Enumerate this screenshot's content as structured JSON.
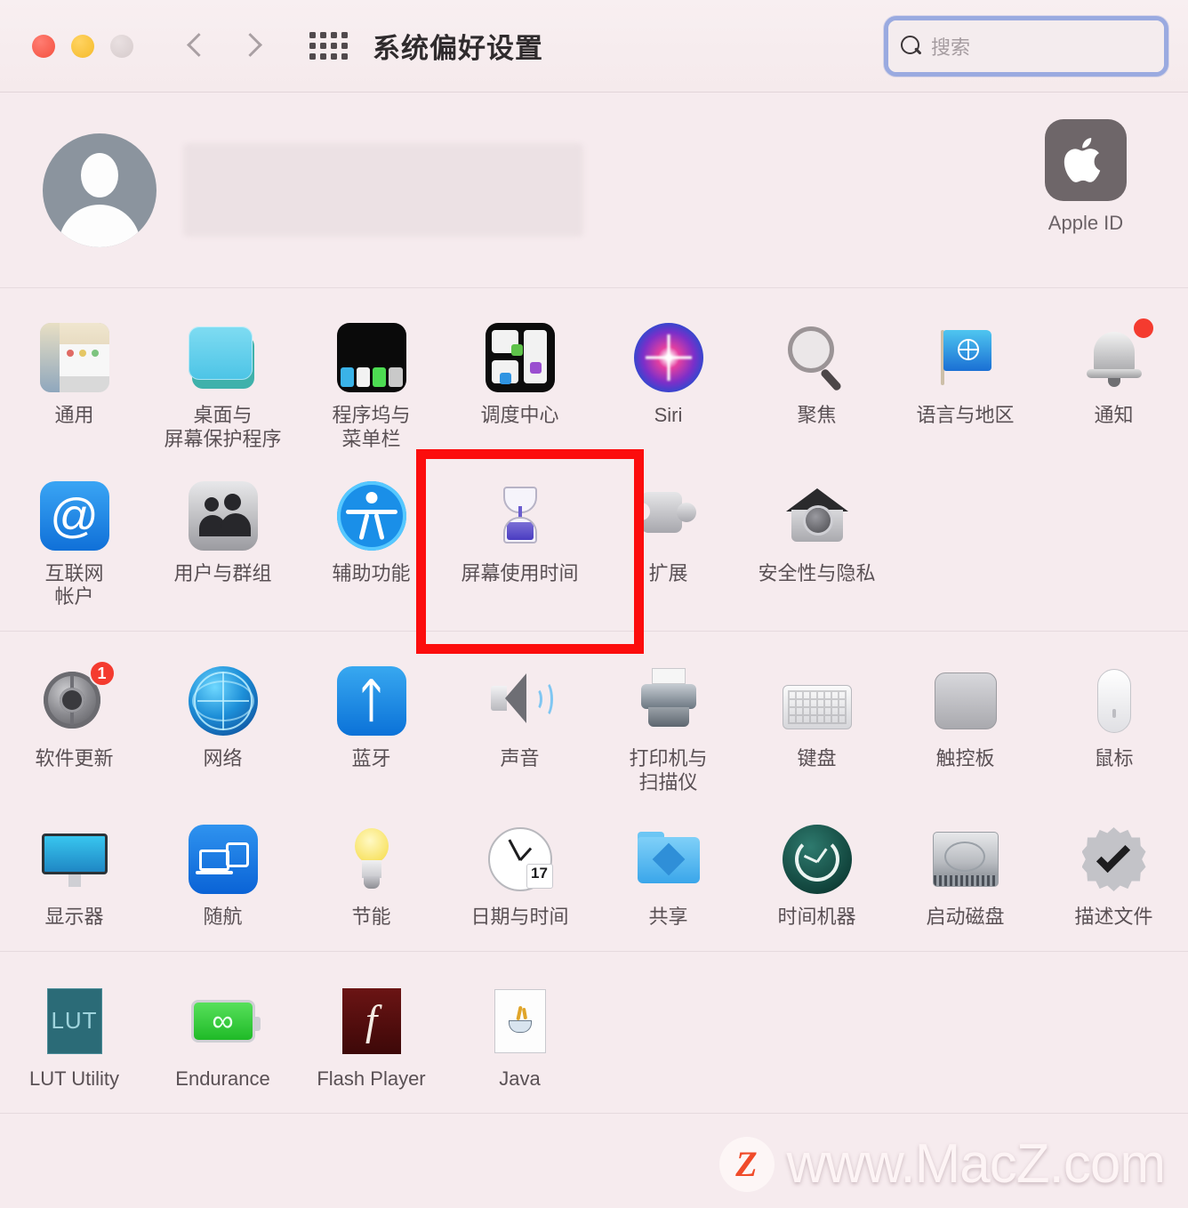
{
  "window": {
    "title": "系统偏好设置",
    "traffic_lights": [
      "close-red",
      "minimize-yellow",
      "zoom-disabled-gray"
    ],
    "nav": {
      "back": "back-chevron",
      "forward": "forward-chevron"
    },
    "show_all_icon": "grid-icon"
  },
  "search": {
    "placeholder": "搜索",
    "value": "",
    "icon": "search-icon",
    "focused": true,
    "focus_ring_color": "#9aaae0"
  },
  "account": {
    "avatar_icon": "default-user-avatar",
    "name_redacted": true,
    "apple_id": {
      "label": "Apple ID",
      "icon": "apple-logo-icon"
    }
  },
  "sections": [
    {
      "name": "personal",
      "items": [
        {
          "label": "通用",
          "icon": "general-icon"
        },
        {
          "label": "桌面与\n屏幕保护程序",
          "icon": "desktop-screensaver-icon"
        },
        {
          "label": "程序坞与\n菜单栏",
          "icon": "dock-menubar-icon"
        },
        {
          "label": "调度中心",
          "icon": "mission-control-icon"
        },
        {
          "label": "Siri",
          "icon": "siri-icon"
        },
        {
          "label": "聚焦",
          "icon": "spotlight-icon"
        },
        {
          "label": "语言与地区",
          "icon": "language-region-icon"
        },
        {
          "label": "通知",
          "icon": "notifications-bell-icon",
          "badge": ""
        },
        {
          "label": "互联网\n帐户",
          "icon": "internet-accounts-icon"
        },
        {
          "label": "用户与群组",
          "icon": "users-groups-icon"
        },
        {
          "label": "辅助功能",
          "icon": "accessibility-icon"
        },
        {
          "label": "屏幕使用时间",
          "icon": "screen-time-hourglass-icon",
          "highlighted": true
        },
        {
          "label": "扩展",
          "icon": "extensions-puzzle-icon"
        },
        {
          "label": "安全性与隐私",
          "icon": "security-privacy-icon"
        }
      ]
    },
    {
      "name": "hardware",
      "items": [
        {
          "label": "软件更新",
          "icon": "software-update-icon",
          "badge": "1"
        },
        {
          "label": "网络",
          "icon": "network-globe-icon"
        },
        {
          "label": "蓝牙",
          "icon": "bluetooth-icon"
        },
        {
          "label": "声音",
          "icon": "sound-speaker-icon"
        },
        {
          "label": "打印机与\n扫描仪",
          "icon": "printers-scanners-icon"
        },
        {
          "label": "键盘",
          "icon": "keyboard-icon"
        },
        {
          "label": "触控板",
          "icon": "trackpad-icon"
        },
        {
          "label": "鼠标",
          "icon": "mouse-icon"
        },
        {
          "label": "显示器",
          "icon": "displays-icon"
        },
        {
          "label": "随航",
          "icon": "sidecar-icon"
        },
        {
          "label": "节能",
          "icon": "energy-saver-bulb-icon"
        },
        {
          "label": "日期与时间",
          "icon": "date-time-clock-icon",
          "calendar_day": "17"
        },
        {
          "label": "共享",
          "icon": "sharing-folder-icon"
        },
        {
          "label": "时间机器",
          "icon": "time-machine-icon"
        },
        {
          "label": "启动磁盘",
          "icon": "startup-disk-icon"
        },
        {
          "label": "描述文件",
          "icon": "profiles-icon"
        }
      ]
    },
    {
      "name": "third-party",
      "items": [
        {
          "label": "LUT Utility",
          "icon": "lut-utility-icon",
          "icon_text": "LUT"
        },
        {
          "label": "Endurance",
          "icon": "endurance-battery-icon",
          "icon_text": "∞"
        },
        {
          "label": "Flash Player",
          "icon": "flash-player-icon",
          "icon_text": "f"
        },
        {
          "label": "Java",
          "icon": "java-cup-icon"
        }
      ]
    }
  ],
  "annotation": {
    "highlight_color": "#fc0d0d",
    "target_label": "屏幕使用时间"
  },
  "watermark": {
    "logo_letter": "Z",
    "text": "www.MacZ.com"
  }
}
